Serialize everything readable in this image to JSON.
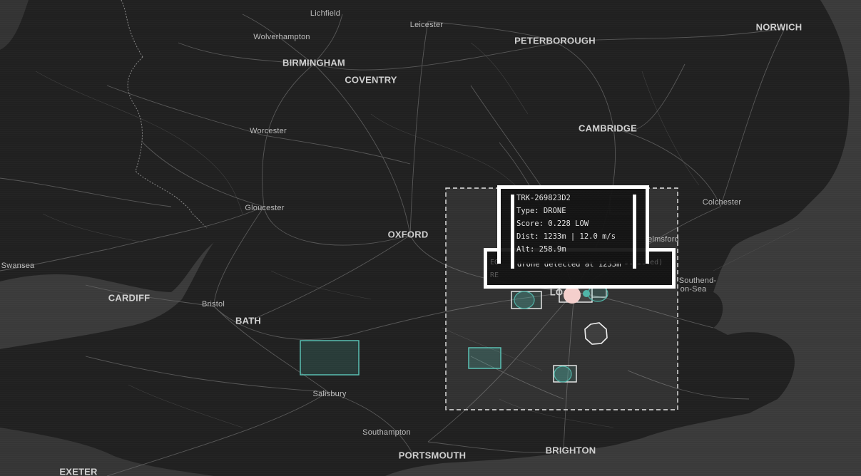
{
  "map": {
    "cities_major": [
      {
        "name": "BIRMINGHAM"
      },
      {
        "name": "COVENTRY"
      },
      {
        "name": "PETERBOROUGH"
      },
      {
        "name": "NORWICH"
      },
      {
        "name": "CAMBRIDGE"
      },
      {
        "name": "OXFORD"
      },
      {
        "name": "CARDIFF"
      },
      {
        "name": "BATH"
      },
      {
        "name": "PORTSMOUTH"
      },
      {
        "name": "BRIGHTON"
      },
      {
        "name": "EXETER"
      }
    ],
    "cities_minor": [
      {
        "name": "Lichfield"
      },
      {
        "name": "Leicester"
      },
      {
        "name": "Wolverhampton"
      },
      {
        "name": "Worcester"
      },
      {
        "name": "Gloucester"
      },
      {
        "name": "Colchester"
      },
      {
        "name": "Swansea"
      },
      {
        "name": "Bristol"
      },
      {
        "name": "Salisbury"
      },
      {
        "name": "Southampton"
      },
      {
        "name": "Southend-"
      },
      {
        "name": "on-Sea"
      },
      {
        "name": "elmsford"
      }
    ],
    "london_label": "LO",
    "colors": {
      "background": "#202020",
      "sea": "#3a3a3a",
      "road": "#6a6a6a",
      "teal": "#4fb5a8",
      "white": "#ffffff"
    }
  },
  "track_popup": {
    "title": "TRK-269823D2",
    "type": "Type: DRONE",
    "score": "Score: 0.228 LOW",
    "dist": "Dist: 1233m | 12.0 m/s",
    "alt": "Alt: 258.9m"
  },
  "alert_popup": {
    "text": "drone detected at 1233m",
    "behind_left": "EG",
    "behind_right": "stricted)",
    "behind_sub": "RE"
  }
}
